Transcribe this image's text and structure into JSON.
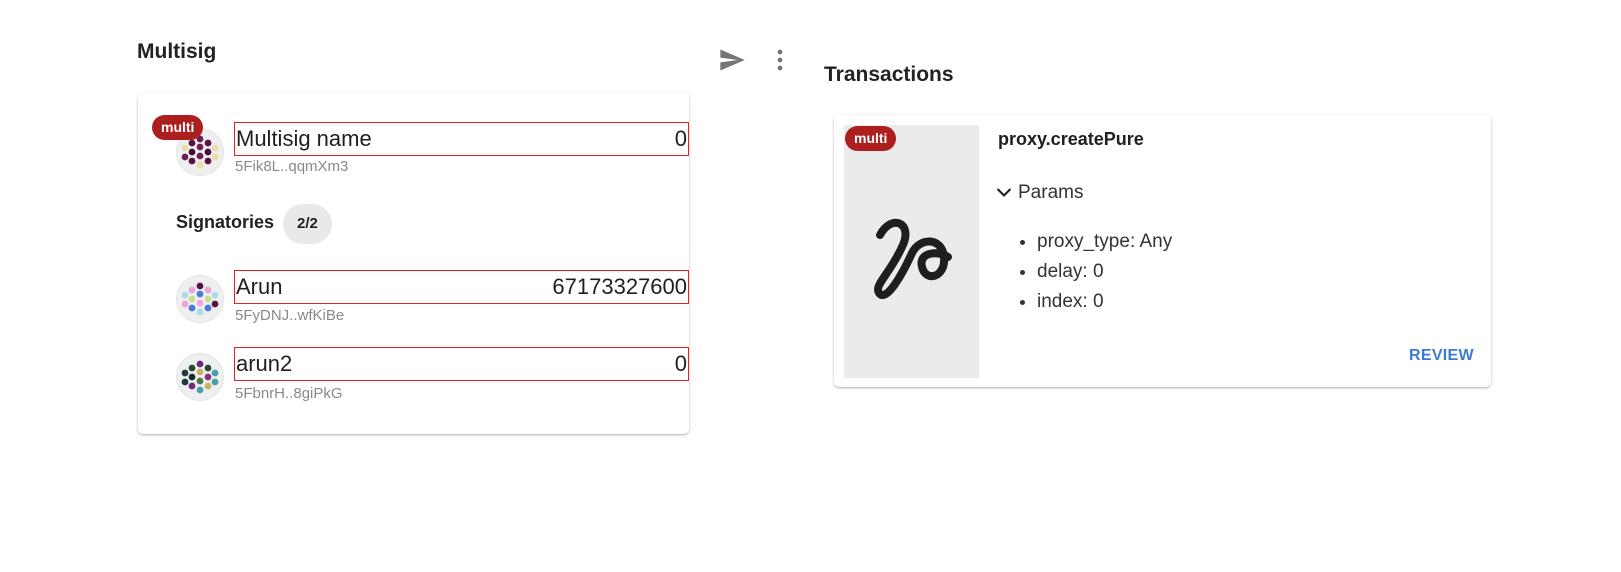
{
  "multisig": {
    "heading": "Multisig",
    "account": {
      "badge": "multi",
      "name": "Multisig name",
      "amount": "0",
      "address": "5Fik8L..qqmXm3"
    },
    "signatories_label": "Signatories",
    "signatories_count": "2/2",
    "signatories": [
      {
        "name": "Arun",
        "amount": "67173327600",
        "address": "5FyDNJ..wfKiBe"
      },
      {
        "name": "arun2",
        "amount": "0",
        "address": "5FbnrH..8giPkG"
      }
    ]
  },
  "toolbar": {
    "send_icon": "send-icon",
    "more_icon": "more-vertical-icon"
  },
  "transactions": {
    "heading": "Transactions",
    "items": [
      {
        "badge": "multi",
        "method": "proxy.createPure",
        "params_label": "Params",
        "params": [
          "proxy_type: Any",
          "delay: 0",
          "index: 0"
        ],
        "action": "REVIEW"
      }
    ]
  },
  "colors": {
    "badge": "#ad1f1f",
    "highlight_border": "#e02424",
    "link": "#3d7ad6",
    "thumbnail_bg": "#ebebeb"
  }
}
